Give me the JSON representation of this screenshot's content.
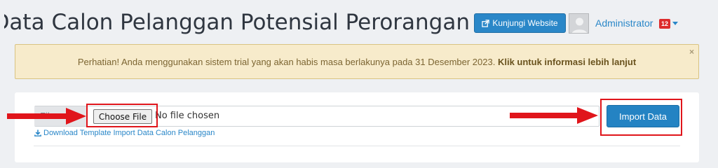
{
  "header": {
    "title": "Import Data Calon Pelanggan Potensial Perorangan",
    "visit_button": "Kunjungi Website",
    "user_name": "Administrator",
    "notification_count": "12"
  },
  "alert": {
    "message": "Perhatian! Anda menggunakan sistem trial yang akan habis masa berlakunya pada 31 Desember 2023.",
    "link": "Klik untuk informasi lebih lanjut",
    "close": "×"
  },
  "form": {
    "file_label": "File",
    "choose_button": "Choose File",
    "file_status": "No file chosen",
    "import_button": "Import Data",
    "download_link": "Download Template Import Data Calon Pelanggan"
  },
  "annotation_color": "#e0151b",
  "accent_color": "#2a87c8",
  "icons": [
    "external-link-icon",
    "avatar-icon",
    "caret-down-icon",
    "close-icon",
    "download-icon",
    "arrow-right-icon"
  ]
}
